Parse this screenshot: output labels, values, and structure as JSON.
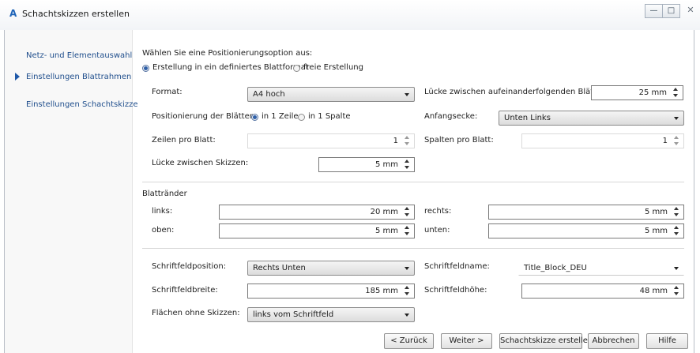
{
  "window": {
    "title": "Schachtskizzen erstellen",
    "logo": "A",
    "controls": [
      "minimize-icon",
      "restore-icon",
      "close-icon"
    ]
  },
  "sidebar": {
    "items": [
      {
        "label": "Netz- und Elementauswahl"
      },
      {
        "label": "Einstellungen Blattrahmen",
        "active": true
      },
      {
        "label": "Einstellungen Schachtskizze"
      }
    ]
  },
  "positioning": {
    "prompt": "Wählen Sie eine Positionierungsoption aus:",
    "option_defined": "Erstellung in ein definiertes Blattformat",
    "option_free": "freie Erstellung",
    "selected": "option_defined"
  },
  "sheet": {
    "format_label": "Format:",
    "format_value": "A4 hoch",
    "gap_sheets_label": "Lücke zwischen aufeinanderfolgenden Blättern:",
    "gap_sheets_value": "25 mm",
    "positioning_label": "Positionierung der Blätter:",
    "pos_row": "in 1 Zeile",
    "pos_col": "in 1 Spalte",
    "pos_selected": "pos_row",
    "start_corner_label": "Anfangsecke:",
    "start_corner_value": "Unten Links",
    "rows_label": "Zeilen pro Blatt:",
    "rows_value": "1",
    "cols_label": "Spalten pro Blatt:",
    "cols_value": "1",
    "gap_sketch_label": "Lücke zwischen Skizzen:",
    "gap_sketch_value": "5 mm"
  },
  "margins": {
    "heading": "Blattränder",
    "left_label": "links:",
    "left_value": "20 mm",
    "right_label": "rechts:",
    "right_value": "5 mm",
    "top_label": "oben:",
    "top_value": "5 mm",
    "bottom_label": "unten:",
    "bottom_value": "5 mm"
  },
  "titleblock": {
    "position_label": "Schriftfeldposition:",
    "position_value": "Rechts Unten",
    "name_label": "Schriftfeldname:",
    "name_value": "Title_Block_DEU",
    "width_label": "Schriftfeldbreite:",
    "width_value": "185 mm",
    "height_label": "Schriftfeldhöhe:",
    "height_value": "48 mm",
    "empty_label": "Flächen ohne Skizzen:",
    "empty_value": "links vom Schriftfeld"
  },
  "buttons": {
    "back": "< Zurück",
    "next": "Weiter >",
    "create": "Schachtskizze erstellen",
    "cancel": "Abbrechen",
    "help": "Hilfe"
  }
}
